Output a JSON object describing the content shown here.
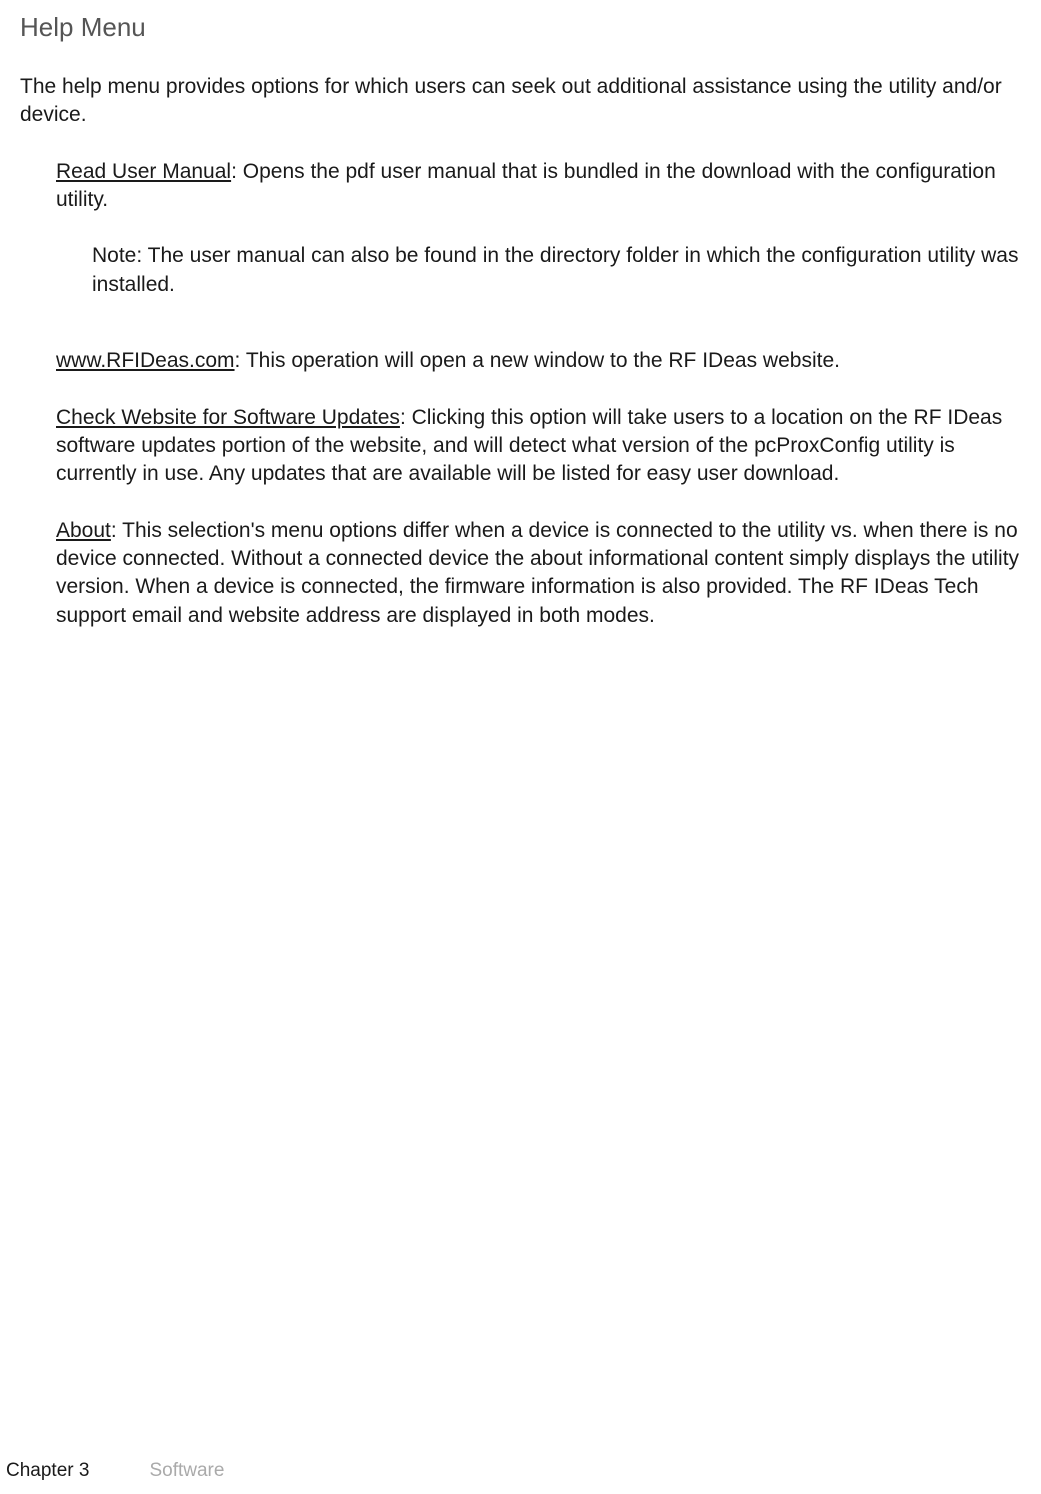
{
  "heading": "Help Menu",
  "intro": "The help menu provides options for which users can seek out additional assistance using the utility and/or device.",
  "items": {
    "read_manual": {
      "label": "Read User Manual",
      "text": ":  Opens the pdf user manual that is bundled in the download with the configuration utility."
    },
    "note": "Note: The user manual can also be found in the directory folder in which the configuration utility was installed.",
    "website": {
      "label": "www.RFIDeas.com",
      "text": ": This operation will open a new window to the RF IDeas  website."
    },
    "check_updates": {
      "label": "Check Website for Software Updates",
      "text": ": Clicking this option will take users to a location on the RF IDeas software updates portion of the website, and will detect what version of the pcProxConfig utility is currently in use. Any updates that are available will be listed for easy user download."
    },
    "about": {
      "label": "About",
      "text": ": This selection's menu options differ when a device is connected to the utility vs. when there is no device connected. Without a connected device the about informational content simply displays the utility version. When a device is connected, the firmware information is also provided. The RF IDeas  Tech  support email and website address are displayed in both modes."
    }
  },
  "footer": {
    "chapter": "Chapter 3",
    "section": "Software"
  }
}
